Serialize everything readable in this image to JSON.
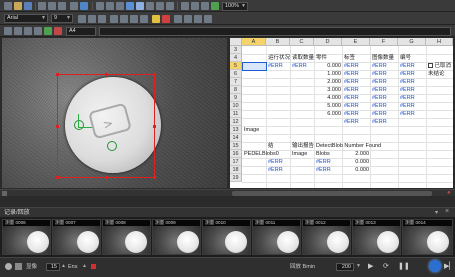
{
  "toolbar": {
    "zoom_value": "100%",
    "font_name": "Arial",
    "font_size": "9",
    "cell_ref": "A4"
  },
  "colors": {
    "accent": "#1a5fd6",
    "roi": "#e02020",
    "header_bg": "#e4e4e4"
  },
  "sheet": {
    "columns": [
      "A",
      "B",
      "C",
      "D",
      "E",
      "F",
      "G",
      "H"
    ],
    "rows": [
      "3",
      "4",
      "5",
      "6",
      "7",
      "8",
      "9",
      "10",
      "11",
      "12",
      "13",
      "14",
      "15",
      "16",
      "17",
      "18",
      "19"
    ],
    "r4": [
      "运行状况",
      "读取数量",
      "零件",
      "标签",
      "图像数量",
      "编号",
      ""
    ],
    "r5": [
      "#ERR",
      "#ERR",
      "0.000",
      "#ERR",
      "#ERR",
      "#ERR",
      "已取消"
    ],
    "r6": [
      "1.000",
      "#ERR",
      "#ERR",
      "#ERR",
      "未结论"
    ],
    "r7": [
      "2.000",
      "#ERR",
      "#ERR",
      "#ERR"
    ],
    "r8": [
      "3.000",
      "#ERR",
      "#ERR",
      "#ERR"
    ],
    "r9": [
      "4.000",
      "#ERR",
      "#ERR",
      "#ERR"
    ],
    "r10": [
      "5.000",
      "#ERR",
      "#ERR",
      "#ERR"
    ],
    "r11": [
      "6.000",
      "#ERR",
      "#ERR",
      "#ERR"
    ],
    "r12": [
      "#ERR",
      "#ERR"
    ],
    "r13": [
      "Image"
    ],
    "r15": [
      "结",
      "输出报告",
      "DetectBlob Number Found"
    ],
    "r16": [
      "PEDELBlobs0",
      "Image",
      "Blobs",
      "2.000"
    ],
    "r17": [
      "#ERR",
      "#ERR",
      "0.000"
    ],
    "r18": [
      "#ERR",
      "#ERR",
      "0.000"
    ]
  },
  "record": {
    "title": "记录/回放",
    "frames": [
      "测量 0006",
      "测量 0007",
      "测量 0008",
      "测量 0009",
      "测量 0010",
      "测量 0011",
      "测量 0012",
      "测量 0013",
      "测量 0014"
    ]
  },
  "playback": {
    "label": "显像",
    "count": "15",
    "unit": "Ens",
    "time_label": "回放 Bmin",
    "time_value": "200"
  }
}
